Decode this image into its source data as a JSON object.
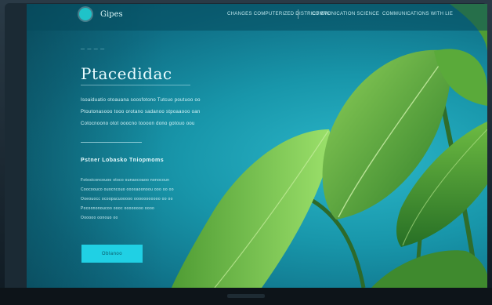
{
  "header": {
    "brand": "Gipes",
    "nav_items": [
      "CHANGES COMPUTERIZED DISTRICT ETC",
      "COMMUNICATION SCIENCE",
      "COMMUNICATIONS WITH LIE"
    ]
  },
  "hero": {
    "kicker": "— — — —",
    "title": "Ptacedidac",
    "lead_lines": [
      "Isoaiduatio otoauana soosfotono Tutcuo poutuoo oo",
      "Ptoutonasooo tooo orotano sadanoo stpoaaooo oan",
      "Cotocnoono otot ooocno toooon dono gotouo oou"
    ]
  },
  "section": {
    "title": "Pstner Lobasko Tniopmoms",
    "body_lines": [
      "Fotosiconcouoo otoco ounaocoaoo nonocoun",
      "Coocoouco ouocncouo oooxaoonoou ooo oo oo",
      "Ooeouocc ocoopacuooooo ooooooooooo oo oo",
      "Pocoononoucoo oooc oooooooo oooo",
      "Oooooo oonouo oo"
    ]
  },
  "cta": {
    "label": "Oblanoo"
  },
  "colors": {
    "accent": "#20d0e4",
    "screen_dark": "#0b5a70",
    "screen_light": "#2bb7c9",
    "leaf": "#5fae3a"
  }
}
